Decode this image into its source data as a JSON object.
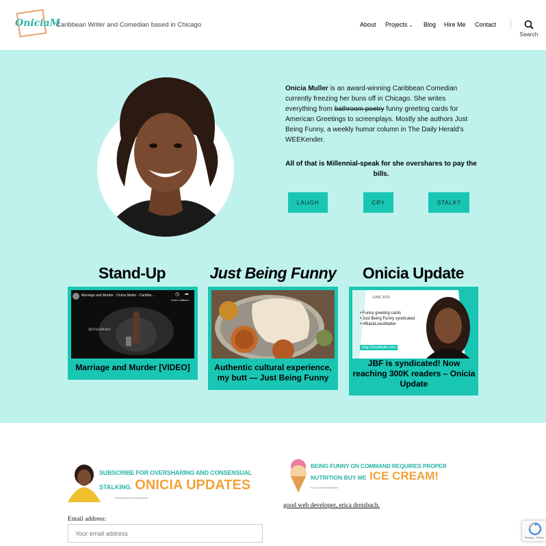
{
  "site": {
    "logo_text": "OniciaM",
    "tagline": "Caribbean Writer and Comedian based in Chicago"
  },
  "nav": {
    "items": [
      "About",
      "Projects",
      "Blog",
      "Hire Me",
      "Contact"
    ],
    "search_label": "Search"
  },
  "hero": {
    "bio_name": "Onicia Muller",
    "bio_part1": " is an award-winning Caribbean Comedian currently freezing her buns off in Chicago. She writes everything from ",
    "bio_struck": "bathroom poetry",
    "bio_part2": " funny greeting cards for American Greetings to screenplays. Mostly she authors Just Being Funny, a weekly humor column in The Daily Herald’s WEEKender.",
    "bills": "All of that is Millennial-speak for she overshares to pay the bills.",
    "buttons": [
      "LAUGH",
      "CRY",
      "STALK?"
    ]
  },
  "columns": [
    {
      "title": "Stand-Up",
      "caption": "Marriage and Murder [VIDEO]",
      "video_title": "Marriage and Murder - Onicia Muller - Caribbe...",
      "watch_later": "Watch later",
      "share": "Share",
      "video_handle": "@OniciaMuller"
    },
    {
      "title": "Just Being Funny",
      "caption": "Authentic cultural experience, my butt — Just Being Funny"
    },
    {
      "title": "Onicia Update",
      "caption": "JBF is syndicated! Now reaching 300K readers – Onicia Update",
      "thumb_date": "JUNE 2020",
      "thumb_bullets": [
        "Funny greeting cards",
        "Just Being Funny syndicated",
        "#BlackLivesMatter"
      ],
      "thumb_url": "blog.OniciaMuller.com"
    }
  ],
  "footer": {
    "subscribe_line1": "SUBSCRIBE FOR OVERSHARING AND CONSENSUAL",
    "subscribe_line2a": "STALKING.",
    "subscribe_line2b": "ONICIA UPDATES",
    "subscribe_small": "OniciaMuller.com/subscribe",
    "ice_line1": "BEING FUNNY ON COMMAND REQUIRES PROPER",
    "ice_line2a": "NUTRITION BUY ME",
    "ice_line2b": "ICE CREAM!",
    "ice_small": "Ko-fi.com/OniciaMuller",
    "dev_link": "good web developer, erica dreisbach.",
    "email_label": "Email address:",
    "email_placeholder": "Your email address",
    "recaptcha_text": "Privacy - Terms"
  },
  "colors": {
    "hero_bg": "#bff2ed",
    "accent": "#19c6b4",
    "subscribe_orange": "#f2a23a",
    "subscribe_teal": "#2bb3a6"
  }
}
